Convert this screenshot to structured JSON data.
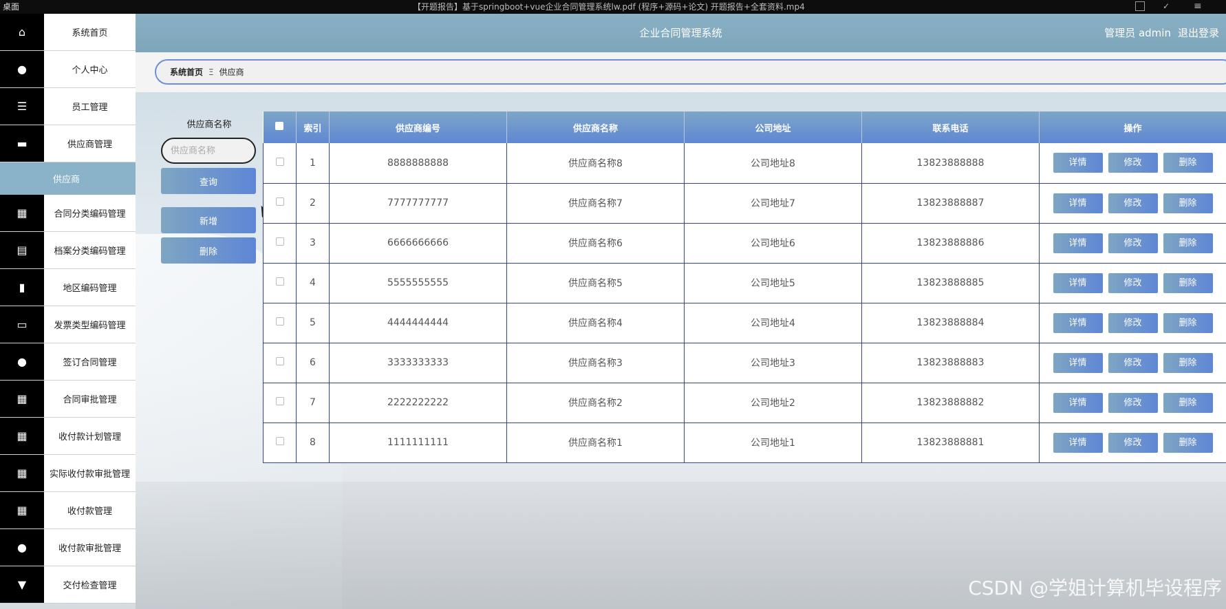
{
  "window": {
    "left_text": "桌面",
    "title_text": "【开题报告】基于springboot+vue企业合同管理系统lw.pdf (程序+源码+论文) 开题报告+全套资料.mp4"
  },
  "header": {
    "title": "企业合同管理系统",
    "user_label": "管理员 admin",
    "logout_label": "退出登录"
  },
  "breadcrumb": {
    "home": "系统首页",
    "separator": "Ξ",
    "current": "供应商"
  },
  "sidebar": {
    "items": [
      {
        "label": "系统首页",
        "icon": "home-icon",
        "glyph": "⌂"
      },
      {
        "label": "个人中心",
        "icon": "user-icon",
        "glyph": "●"
      },
      {
        "label": "员工管理",
        "icon": "list-icon",
        "glyph": "☰"
      },
      {
        "label": "供应商管理",
        "icon": "monitor-icon",
        "glyph": "▬"
      },
      {
        "label": "合同分类编码管理",
        "icon": "grid-icon",
        "glyph": "▦"
      },
      {
        "label": "档案分类编码管理",
        "icon": "clipboard-icon",
        "glyph": "▤"
      },
      {
        "label": "地区编码管理",
        "icon": "chart-icon",
        "glyph": "▮"
      },
      {
        "label": "发票类型编码管理",
        "icon": "monitor-icon",
        "glyph": "▭"
      },
      {
        "label": "签订合同管理",
        "icon": "user-icon",
        "glyph": "●"
      },
      {
        "label": "合同审批管理",
        "icon": "grid-icon",
        "glyph": "▦"
      },
      {
        "label": "收付款计划管理",
        "icon": "grid-icon",
        "glyph": "▦"
      },
      {
        "label": "实际收付款审批管理",
        "icon": "grid-icon",
        "glyph": "▦"
      },
      {
        "label": "收付款管理",
        "icon": "grid-icon",
        "glyph": "▦"
      },
      {
        "label": "收付款审批管理",
        "icon": "user-icon",
        "glyph": "●"
      },
      {
        "label": "交付检查管理",
        "icon": "pin-icon",
        "glyph": "▼"
      }
    ],
    "sub_item": "供应商"
  },
  "search": {
    "label": "供应商名称",
    "placeholder": "供应商名称",
    "query_button": "查询",
    "add_button": "新增",
    "delete_button": "删除"
  },
  "table": {
    "headers": [
      "索引",
      "供应商编号",
      "供应商名称",
      "公司地址",
      "联系电话",
      "操作"
    ],
    "actions": {
      "detail": "详情",
      "edit": "修改",
      "delete": "删除"
    },
    "rows": [
      {
        "index": "1",
        "code": "8888888888",
        "name": "供应商名称8",
        "address": "公司地址8",
        "phone": "13823888888"
      },
      {
        "index": "2",
        "code": "7777777777",
        "name": "供应商名称7",
        "address": "公司地址7",
        "phone": "13823888887"
      },
      {
        "index": "3",
        "code": "6666666666",
        "name": "供应商名称6",
        "address": "公司地址6",
        "phone": "13823888886"
      },
      {
        "index": "4",
        "code": "5555555555",
        "name": "供应商名称5",
        "address": "公司地址5",
        "phone": "13823888885"
      },
      {
        "index": "5",
        "code": "4444444444",
        "name": "供应商名称4",
        "address": "公司地址4",
        "phone": "13823888884"
      },
      {
        "index": "6",
        "code": "3333333333",
        "name": "供应商名称3",
        "address": "公司地址3",
        "phone": "13823888883"
      },
      {
        "index": "7",
        "code": "2222222222",
        "name": "供应商名称2",
        "address": "公司地址2",
        "phone": "13823888882"
      },
      {
        "index": "8",
        "code": "1111111111",
        "name": "供应商名称1",
        "address": "公司地址1",
        "phone": "13823888881"
      }
    ]
  },
  "watermark": "CSDN @学姐计算机毕设程序"
}
